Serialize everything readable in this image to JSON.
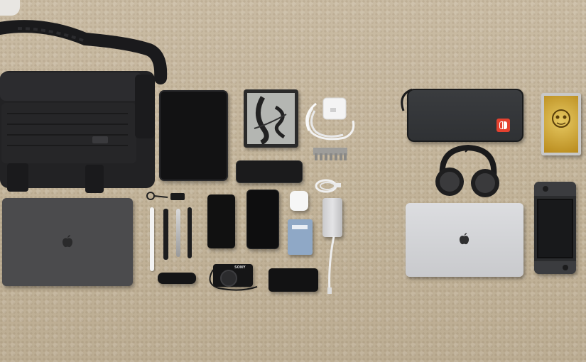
{
  "scene": {
    "colors": {
      "carpet": "#c3b49b",
      "dark_gear": "#1c1c1e",
      "space_gray": "#4a4a4c",
      "silver": "#cfd0d3",
      "switch_red": "#e4412f",
      "gold": "#d9b23a"
    },
    "camera_brand": "SONY",
    "items": [
      "messenger-bag",
      "tablet",
      "e-reader",
      "usb-c-power-adapter",
      "usb-c-cable",
      "sd-card-holder",
      "bluetooth-speaker",
      "space-gray-laptop",
      "stylus-pen",
      "pens",
      "smartphone",
      "smartphone",
      "earbuds-case",
      "usb-c-hub",
      "cable",
      "usb-drive",
      "multitool",
      "compact-camera",
      "portable-battery",
      "switch-carrying-case",
      "headphones",
      "silver-laptop",
      "game-case",
      "handheld-console"
    ]
  }
}
